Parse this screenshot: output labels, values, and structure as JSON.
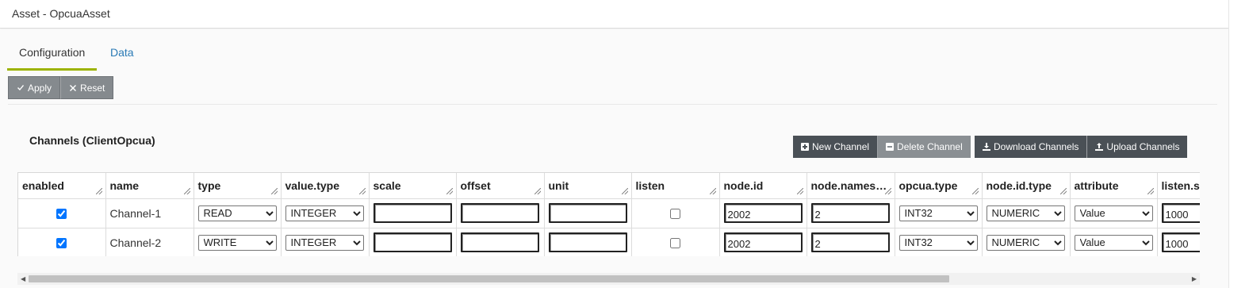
{
  "window": {
    "title": "Asset - OpcuaAsset"
  },
  "tabs": [
    {
      "label": "Configuration",
      "active": true
    },
    {
      "label": "Data",
      "active": false
    }
  ],
  "toolbar": {
    "apply_label": "Apply",
    "reset_label": "Reset"
  },
  "channels": {
    "title": "Channels (ClientOpcua)",
    "buttons": {
      "new": "New Channel",
      "delete": "Delete Channel",
      "download": "Download Channels",
      "upload": "Upload Channels"
    },
    "columns": [
      "enabled",
      "name",
      "type",
      "value.type",
      "scale",
      "offset",
      "unit",
      "listen",
      "node.id",
      "node.names…",
      "opcua.type",
      "node.id.type",
      "attribute",
      "listen.s"
    ],
    "rows": [
      {
        "enabled": true,
        "name": "Channel-1",
        "type": "READ",
        "value_type": "INTEGER",
        "scale": "",
        "offset": "",
        "unit": "",
        "listen": false,
        "node_id": "2002",
        "node_namespace": "2",
        "opcua_type": "INT32",
        "node_id_type": "NUMERIC",
        "attribute": "Value",
        "listen_s": "1000"
      },
      {
        "enabled": true,
        "name": "Channel-2",
        "type": "WRITE",
        "value_type": "INTEGER",
        "scale": "",
        "offset": "",
        "unit": "",
        "listen": false,
        "node_id": "2002",
        "node_namespace": "2",
        "opcua_type": "INT32",
        "node_id_type": "NUMERIC",
        "attribute": "Value",
        "listen_s": "1000"
      }
    ]
  },
  "colors": {
    "active_tab": "#9cb300",
    "link": "#2a7ab5",
    "button": "#858a8e",
    "dark_button": "#4a5056"
  }
}
